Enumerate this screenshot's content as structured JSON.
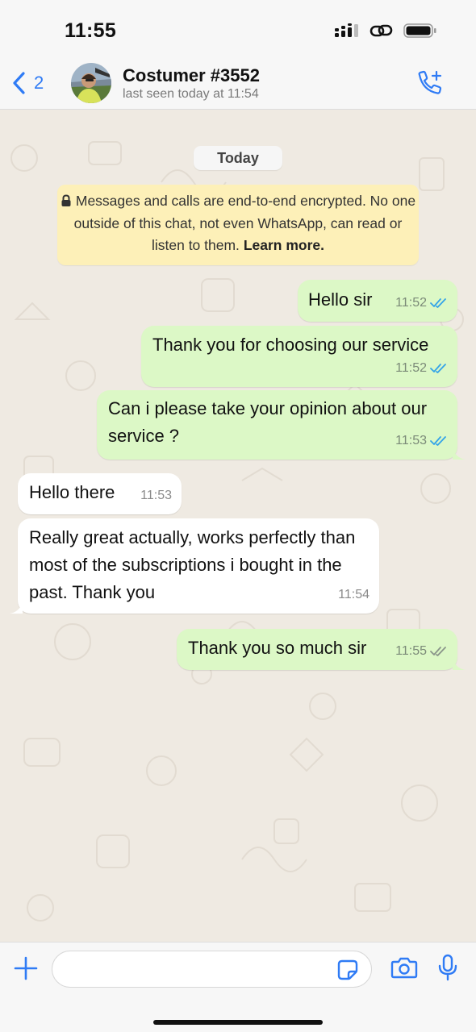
{
  "status": {
    "time": "11:55"
  },
  "header": {
    "back_count": "2",
    "contact_name": "Costumer #3552",
    "last_seen": "last seen today at 11:54"
  },
  "chat": {
    "date_divider": "Today",
    "encryption_notice": {
      "text": "Messages and calls are end-to-end encrypted. No one outside of this chat, not even WhatsApp, can read or listen to them.",
      "link": "Learn more."
    },
    "messages": [
      {
        "direction": "outgoing",
        "text": "Hello sir",
        "time": "11:52",
        "status": "read"
      },
      {
        "direction": "outgoing",
        "text": "Thank you for choosing our service",
        "time": "11:52",
        "status": "read"
      },
      {
        "direction": "outgoing",
        "text": "Can i please take your opinion about our service ?",
        "time": "11:53",
        "status": "read"
      },
      {
        "direction": "incoming",
        "text": "Hello there",
        "time": "11:53"
      },
      {
        "direction": "incoming",
        "text": "Really great actually, works perfectly than most of the subscriptions i bought in the past. Thank you",
        "time": "11:54"
      },
      {
        "direction": "outgoing",
        "text": "Thank you so much sir",
        "time": "11:55",
        "status": "delivered"
      }
    ]
  },
  "composer": {
    "value": "",
    "placeholder": ""
  },
  "colors": {
    "accent": "#2f7bf5",
    "outgoing_bubble": "#dcf8c6",
    "incoming_bubble": "#ffffff",
    "chat_background": "#efeae2",
    "notice_background": "#fdf0b8",
    "read_tick": "#34a4e8",
    "delivered_tick": "#8a958a"
  }
}
